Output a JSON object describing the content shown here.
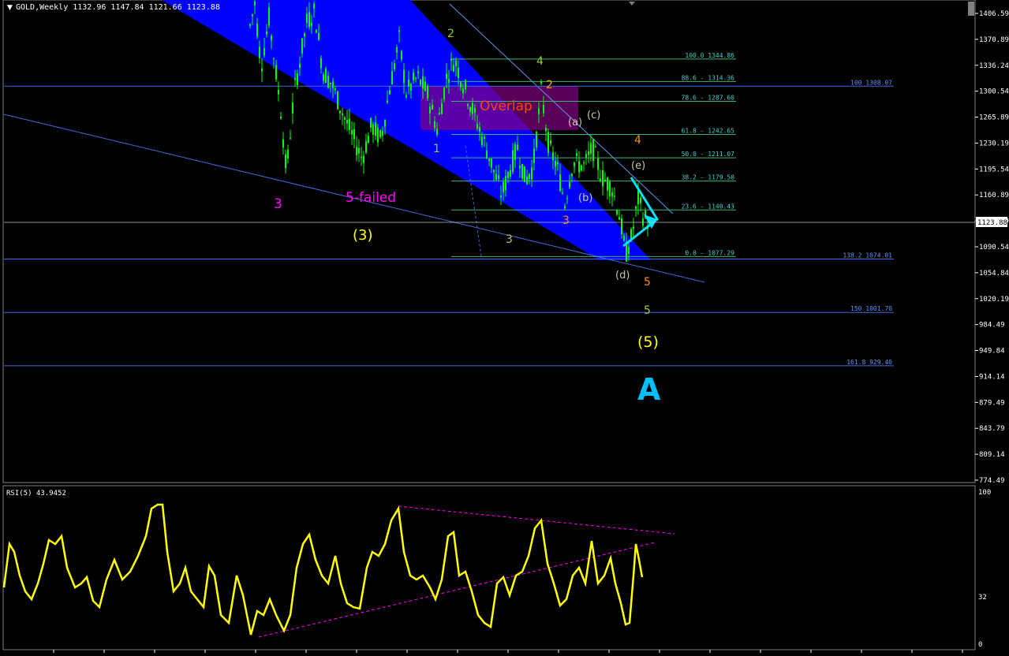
{
  "window": {
    "header": "GOLD,Weekly  1132.96 1147.84 1121.66 1123.88",
    "menu_glyph": "▼"
  },
  "price_scale": {
    "ticks": [
      "1406.59",
      "1370.89",
      "1336.24",
      "1300.54",
      "1265.89",
      "1230.19",
      "1195.54",
      "1160.89",
      "1125.19",
      "1090.54",
      "1054.84",
      "1020.19",
      "984.49",
      "949.84",
      "914.14",
      "879.49",
      "843.79",
      "809.14",
      "774.49"
    ],
    "current_label": "1123.88"
  },
  "fib_levels": [
    {
      "label": "100.0 1344.86",
      "price": 1344.86
    },
    {
      "label": "88.6 - 1314.36",
      "price": 1314.36
    },
    {
      "label": "78.6 - 1287.60",
      "price": 1287.6
    },
    {
      "label": "61.8 - 1242.65",
      "price": 1242.65
    },
    {
      "label": "50.0 - 1211.07",
      "price": 1211.07
    },
    {
      "label": "38.2 - 1179.50",
      "price": 1179.5
    },
    {
      "label": "23.6 - 1140.43",
      "price": 1140.43
    },
    {
      "label": "0.0 - 1077.29",
      "price": 1077.29
    }
  ],
  "ext_levels": [
    {
      "label": "100 1308.07",
      "price": 1308.07
    },
    {
      "label": "138.2 1074.01",
      "price": 1074.01
    },
    {
      "label": "150 1001.70",
      "price": 1001.7
    },
    {
      "label": "161.8 929.40",
      "price": 929.4
    }
  ],
  "wave_labels": [
    {
      "text": "2",
      "color": "#9acd32"
    },
    {
      "text": "4",
      "color": "#9acd32"
    },
    {
      "text": "2",
      "color": "#ffa500"
    },
    {
      "text": "1",
      "color": "#9acd32"
    },
    {
      "text": "(a)",
      "color": "#c8c8a0"
    },
    {
      "text": "(c)",
      "color": "#c8c8a0"
    },
    {
      "text": "4",
      "color": "#ff8c00"
    },
    {
      "text": "(e)",
      "color": "#c8c8a0"
    },
    {
      "text": "(b)",
      "color": "#c8c8a0"
    },
    {
      "text": "3",
      "color": "#ff8c00"
    },
    {
      "text": "3",
      "color": "#c0c060"
    },
    {
      "text": "3",
      "color": "#ff00ff"
    },
    {
      "text": "5-failed",
      "color": "#ff00ff"
    },
    {
      "text": "(3)",
      "color": "#ffff00"
    },
    {
      "text": "(d)",
      "color": "#c8c8a0"
    },
    {
      "text": "5",
      "color": "#ff8c00"
    },
    {
      "text": "5",
      "color": "#9acd32"
    },
    {
      "text": "(5)",
      "color": "#ffff00"
    },
    {
      "text": "A",
      "color": "#00bfff"
    }
  ],
  "overlap_label": "Overlap",
  "rsi": {
    "header": "RSI(5) 43.9452",
    "scale_ticks": [
      "100",
      "32",
      "0"
    ]
  },
  "colors": {
    "background": "#000000",
    "candle_body": "#00ff00",
    "channel_fill": "#0000ff",
    "trendline": "#4169e1",
    "fib": "#3cb371",
    "overlap_box": "#800080",
    "overlap_text": "#ff4500",
    "rsi_line": "#ffff00",
    "rsi_trend": "#ff00ff",
    "arrow": "#00e5ff"
  }
}
